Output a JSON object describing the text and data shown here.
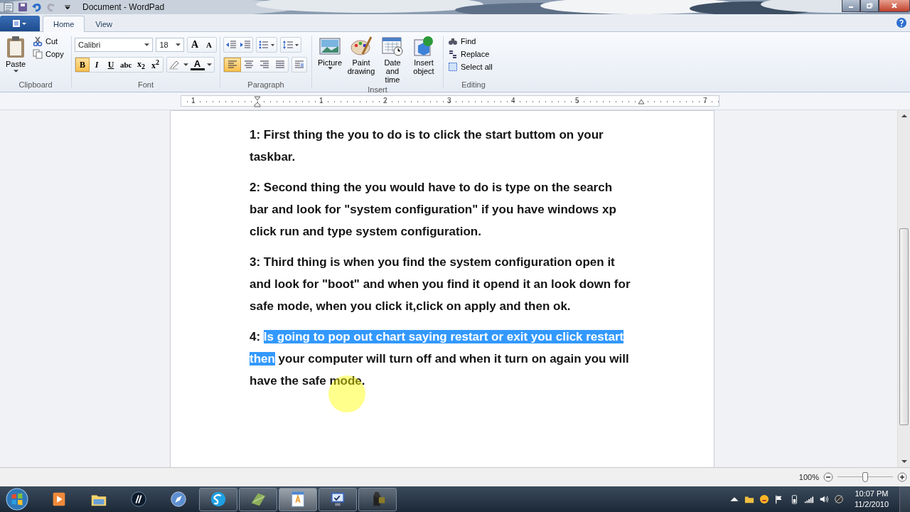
{
  "window": {
    "title": "Document - WordPad"
  },
  "tabs": [
    {
      "label": "Home",
      "selected": true
    },
    {
      "label": "View",
      "selected": false
    }
  ],
  "ribbon": {
    "clipboard": {
      "label": "Clipboard",
      "paste": "Paste",
      "cut": "Cut",
      "copy": "Copy"
    },
    "font": {
      "label": "Font",
      "family": "Calibri",
      "size": "18",
      "size_buttons": [
        {
          "label": "A",
          "kind": "grow"
        },
        {
          "label": "A",
          "kind": "shrink"
        }
      ],
      "format_buttons": [
        {
          "label": "B",
          "kind": "bold",
          "selected": true
        },
        {
          "label": "I",
          "kind": "italic",
          "selected": false
        },
        {
          "label": "U",
          "kind": "underline",
          "selected": false
        },
        {
          "label": "abc",
          "kind": "strike",
          "selected": false
        },
        {
          "label": "x$_{2}$",
          "kind": "plain",
          "selected": false
        },
        {
          "label": "x$^{2}$",
          "kind": "plain",
          "selected": false
        }
      ],
      "color_label": "A"
    },
    "paragraph": {
      "label": "Paragraph",
      "alignments": [
        {
          "kind": "left",
          "selected": true
        },
        {
          "kind": "center",
          "selected": false
        },
        {
          "kind": "right",
          "selected": false
        },
        {
          "kind": "justify",
          "selected": false
        }
      ]
    },
    "insert": {
      "label": "Insert",
      "buttons": [
        {
          "kind": "picture",
          "label": "Picture"
        },
        {
          "kind": "paint",
          "label": "Paint drawing"
        },
        {
          "kind": "date",
          "label": "Date and time"
        },
        {
          "kind": "object",
          "label": "Insert object"
        }
      ]
    },
    "editing": {
      "label": "Editing",
      "buttons": [
        {
          "kind": "find",
          "label": "Find"
        },
        {
          "kind": "replace",
          "label": "Replace"
        },
        {
          "kind": "select",
          "label": "Select all"
        }
      ]
    }
  },
  "ruler": {
    "labels": [
      "1",
      "1",
      "2",
      "3",
      "4",
      "5",
      "7"
    ]
  },
  "document": {
    "paragraphs": [
      [
        {
          "text": "1: First thing the you to do is to click the start buttom on your taskbar.",
          "selected": false
        }
      ],
      [
        {
          "text": "2: Second thing the you would have to do is type on the search bar and look for \"system configuration\" if you have windows xp click run and type system configuration.",
          "selected": false
        }
      ],
      [
        {
          "text": "3: Third thing is when you find the system configuration open it and look for \"boot\" and when you find it opend it an look down for safe mode, when you click it,click on apply and then ok.",
          "selected": false
        }
      ],
      [
        {
          "text": "4: ",
          "selected": false
        },
        {
          "text": "Is going to pop out chart saying restart or exit you click restart then",
          "selected": true
        },
        {
          "text": " your computer will turn off and when it turn on again you will have the safe mode.",
          "selected": false
        }
      ]
    ]
  },
  "status_bar": {
    "zoom": "100%",
    "zoom_slider": {
      "level": 0.5
    }
  },
  "taskbar": {
    "items": [
      {
        "kind": "media",
        "running": false,
        "active": false
      },
      {
        "kind": "folder",
        "running": false,
        "active": false
      },
      {
        "kind": "logo",
        "running": false,
        "active": false
      },
      {
        "kind": "compass",
        "running": false,
        "active": false
      },
      {
        "kind": "chat",
        "running": true,
        "active": false
      },
      {
        "kind": "leaf",
        "running": true,
        "active": false
      },
      {
        "kind": "document",
        "running": true,
        "active": true
      },
      {
        "kind": "monitor",
        "running": true,
        "active": false
      },
      {
        "kind": "camera",
        "running": true,
        "active": false
      }
    ],
    "time": "10:07 PM",
    "date": "11/2/2010"
  }
}
